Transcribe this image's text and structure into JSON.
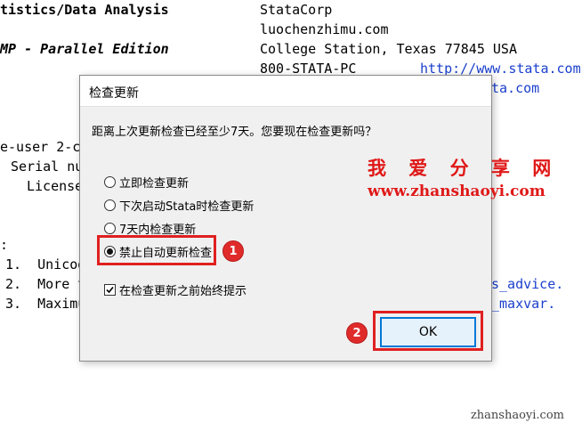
{
  "console": {
    "lines": [
      {
        "text": "tistics/Data Analysis",
        "style": "bold"
      },
      {
        "text": "StataCorp"
      },
      {
        "text": "luochenzhimu.com"
      },
      {
        "text": "MP - Parallel Edition",
        "style": "bold-italic"
      },
      {
        "text": "College Station, Texas 77845 USA"
      },
      {
        "text": "800-STATA-PC"
      },
      {
        "text": "http://www.stata.com"
      },
      {
        "text": "ta.com"
      },
      {
        "text": "e-user 2-co"
      },
      {
        "text": "Serial nu"
      },
      {
        "text": "License"
      },
      {
        "text": ":"
      },
      {
        "text": "1.  Unicod"
      },
      {
        "text": "2.  More t"
      },
      {
        "text": "s_advice."
      },
      {
        "text": "3.  Maximu"
      },
      {
        "text": "_maxvar."
      }
    ],
    "watermark": "zhanshaoyi.com"
  },
  "dialog": {
    "title": "检查更新",
    "prompt": "距离上次更新检查已经至少7天。您要现在检查更新吗？",
    "options": [
      {
        "label": "立即检查更新",
        "selected": false
      },
      {
        "label": "下次启动Stata时检查更新",
        "selected": false
      },
      {
        "label": "7天内检查更新",
        "selected": false
      },
      {
        "label": "禁止自动更新检查",
        "selected": true
      }
    ],
    "checkbox": {
      "label": "在检查更新之前始终提示",
      "checked": true
    },
    "ok_label": "OK"
  },
  "annotations": {
    "badge1": "1",
    "badge2": "2",
    "highlight_color": "#e02020"
  },
  "overlay_watermark": {
    "cn": "我 爱 分 享 网",
    "url": "www.zhanshaoyi.com",
    "color": "#e01818"
  }
}
